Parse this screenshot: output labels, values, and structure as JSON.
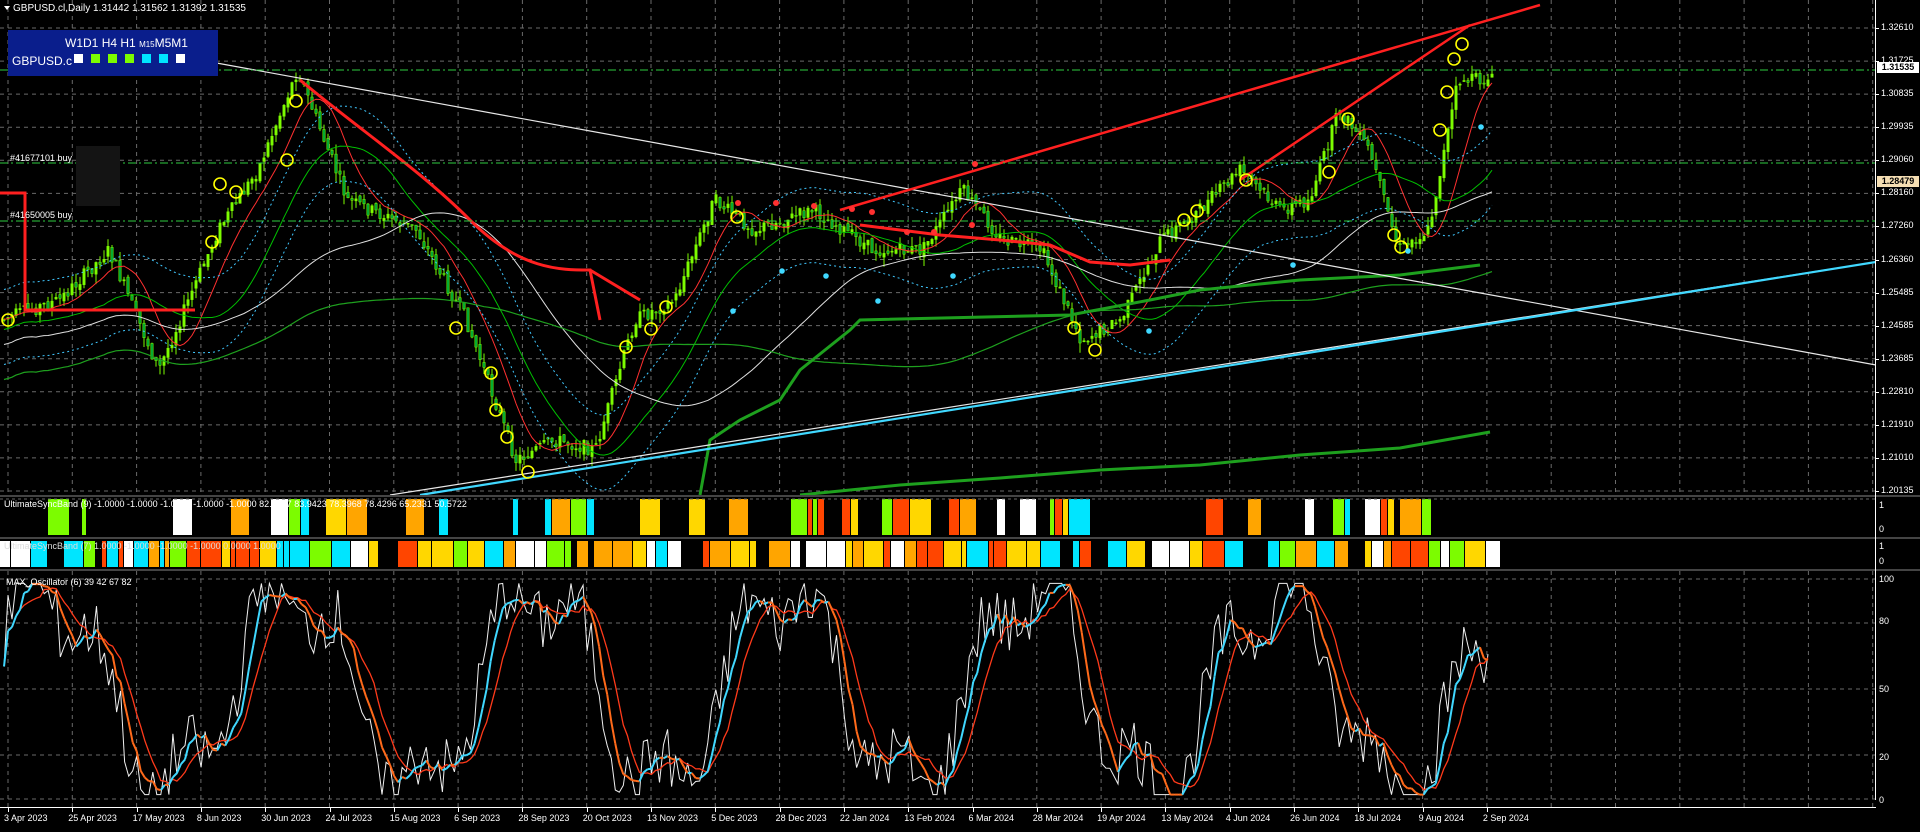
{
  "chart": {
    "symbol_line": "GBPUSD.cl,Daily  1.31442 1.31562 1.31392 1.31535",
    "timeframes": [
      "W1",
      "D1",
      "H4",
      "H1",
      "M15",
      "M5",
      "M1"
    ],
    "symbol_short": "GBPUSD.c",
    "tf_box_colors": [
      "#ffffff",
      "#7cfc00",
      "#7cfc00",
      "#7cfc00",
      "#00e5ff",
      "#00e5ff",
      "#ffffff"
    ],
    "orders": [
      "#41677101 buy",
      "#41650005 buy"
    ],
    "current_price": "1.31535",
    "marked_price": "1.28479"
  },
  "price_scale": [
    "1.32610",
    "1.31725",
    "1.30835",
    "1.29935",
    "1.29060",
    "1.28160",
    "1.27260",
    "1.26360",
    "1.25485",
    "1.24585",
    "1.23685",
    "1.22810",
    "1.21910",
    "1.21010",
    "1.20135"
  ],
  "indicators": {
    "sync_label": "UltimateSyncBand (9) -1.0000 -1.0000 -1.0000 -1.0000 -1.0000 82.7977 83.9423 78.3968 78.4296 65.2331 50.5722",
    "second_label": "UltimateSyncBand (7) 1.0000 -1.0000 -1.0000 -1.0000 0.0000 1.0000",
    "sync_scale": [
      "1",
      "0"
    ],
    "second_scale": [
      "1",
      "0"
    ],
    "osc_label": "MAX_Oscillator (6) 39 42 67 82",
    "osc_scale": [
      "100",
      "80",
      "50",
      "20",
      "0"
    ]
  },
  "dates": [
    "3 Apr 2023",
    "25 Apr 2023",
    "17 May 2023",
    "8 Jun 2023",
    "30 Jun 2023",
    "24 Jul 2023",
    "15 Aug 2023",
    "6 Sep 2023",
    "28 Sep 2023",
    "20 Oct 2023",
    "13 Nov 2023",
    "5 Dec 2023",
    "28 Dec 2023",
    "22 Jan 2024",
    "13 Feb 2024",
    "6 Mar 2024",
    "28 Mar 2024",
    "19 Apr 2024",
    "13 May 2024",
    "4 Jun 2024",
    "26 Jun 2024",
    "18 Jul 2024",
    "9 Aug 2024",
    "2 Sep 2024"
  ],
  "colors": {
    "bull": "#7cfc00",
    "bear": "#7cfc00",
    "red_line": "#ff2020",
    "cyan": "#40d8ff",
    "sync_palette": [
      "#ffffff",
      "#00e5ff",
      "#7cfc00",
      "#ffd700",
      "#ff4500",
      "#ffa500"
    ]
  }
}
